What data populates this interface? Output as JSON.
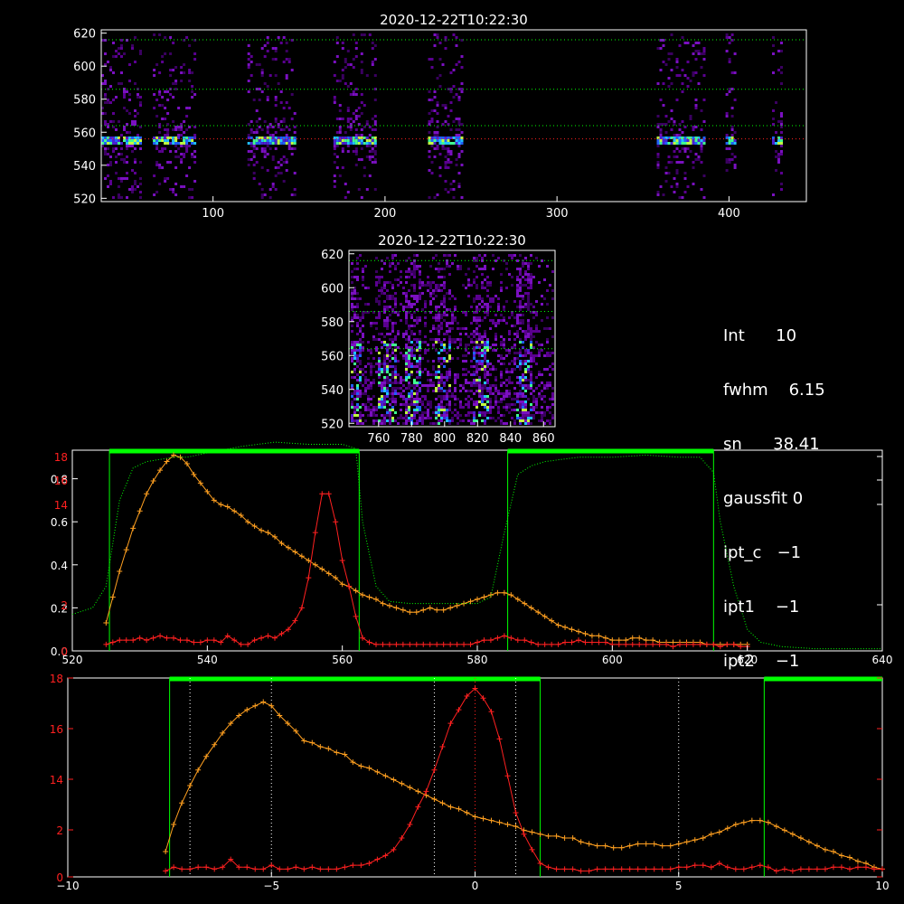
{
  "colors": {
    "background": "#000000",
    "frame": "#ffffff",
    "green": "#00ff00",
    "red": "#ff2020",
    "orange": "#ffa020"
  },
  "info_panel": [
    {
      "label": "Int",
      "value": "10"
    },
    {
      "label": "fwhm",
      "value": "6.15"
    },
    {
      "label": "sn",
      "value": "38.41"
    },
    {
      "label": "gaussfit",
      "value": "0"
    },
    {
      "label": "ipt_c",
      "value": "−1"
    },
    {
      "label": "ipt1",
      "value": "−1"
    },
    {
      "label": "ipt2",
      "value": "−1"
    }
  ],
  "chart_data": [
    {
      "type": "heatmap",
      "title": "2020-12-22T10:22:30",
      "xlim": [
        35,
        445
      ],
      "ylim": [
        518,
        622
      ],
      "xticks": [
        "100",
        "200",
        "300",
        "400"
      ],
      "yticks": [
        "520",
        "540",
        "560",
        "580",
        "600",
        "620"
      ],
      "bright_bands_x": [
        [
          35,
          58
        ],
        [
          65,
          90
        ],
        [
          120,
          148
        ],
        [
          170,
          195
        ],
        [
          225,
          245
        ],
        [
          358,
          385
        ],
        [
          398,
          403
        ],
        [
          425,
          430
        ]
      ],
      "hlines_green_y": [
        616,
        586,
        564
      ],
      "hline_red_y": 556
    },
    {
      "type": "heatmap",
      "title": "2020-12-22T10:22:30",
      "xlim": [
        742,
        867
      ],
      "ylim": [
        518,
        622
      ],
      "xticks": [
        "760",
        "780",
        "800",
        "820",
        "840",
        "860"
      ],
      "yticks": [
        "520",
        "540",
        "560",
        "580",
        "600",
        "620"
      ],
      "hlines_green_y": [
        616,
        586,
        564
      ]
    },
    {
      "type": "line",
      "xlim": [
        520,
        640
      ],
      "xticks": [
        "520",
        "540",
        "560",
        "580",
        "600",
        "620",
        "640"
      ],
      "yticks_white": [
        "0.0",
        "0.2",
        "0.4",
        "0.6",
        "0.8"
      ],
      "yticks_red": [
        "0",
        "2",
        "14",
        "16",
        "18"
      ],
      "green_windows": [
        [
          525.5,
          562.5
        ],
        [
          584.5,
          615
        ]
      ],
      "series": [
        {
          "color": "orange",
          "x": [
            525,
            526,
            527,
            528,
            529,
            530,
            531,
            532,
            533,
            534,
            535,
            536,
            537,
            538,
            539,
            540,
            541,
            542,
            543,
            544,
            545,
            546,
            547,
            548,
            549,
            550,
            551,
            552,
            553,
            554,
            555,
            556,
            557,
            558,
            559,
            560,
            561,
            562,
            563,
            564,
            565,
            566,
            567,
            568,
            569,
            570,
            571,
            572,
            573,
            574,
            575,
            576,
            577,
            578,
            579,
            580,
            581,
            582,
            583,
            584,
            585,
            586,
            587,
            588,
            589,
            590,
            591,
            592,
            593,
            594,
            595,
            596,
            597,
            598,
            599,
            600,
            601,
            602,
            603,
            604,
            605,
            606,
            607,
            608,
            609,
            610,
            611,
            612,
            613,
            614,
            615,
            616,
            617,
            618,
            619,
            620
          ],
          "y": [
            0.13,
            0.25,
            0.37,
            0.47,
            0.57,
            0.65,
            0.73,
            0.79,
            0.84,
            0.88,
            0.91,
            0.9,
            0.87,
            0.82,
            0.78,
            0.74,
            0.7,
            0.68,
            0.67,
            0.65,
            0.63,
            0.6,
            0.58,
            0.56,
            0.55,
            0.53,
            0.5,
            0.48,
            0.46,
            0.44,
            0.42,
            0.4,
            0.38,
            0.36,
            0.34,
            0.31,
            0.3,
            0.28,
            0.26,
            0.25,
            0.24,
            0.22,
            0.21,
            0.2,
            0.19,
            0.18,
            0.18,
            0.19,
            0.2,
            0.19,
            0.19,
            0.2,
            0.21,
            0.22,
            0.23,
            0.24,
            0.25,
            0.26,
            0.27,
            0.27,
            0.26,
            0.24,
            0.22,
            0.2,
            0.18,
            0.16,
            0.14,
            0.12,
            0.11,
            0.1,
            0.09,
            0.08,
            0.07,
            0.07,
            0.06,
            0.05,
            0.05,
            0.05,
            0.06,
            0.06,
            0.05,
            0.05,
            0.04,
            0.04,
            0.04,
            0.04,
            0.04,
            0.04,
            0.04,
            0.03,
            0.03,
            0.03,
            0.03,
            0.03,
            0.03,
            0.03
          ]
        },
        {
          "color": "red",
          "x": [
            525,
            526,
            527,
            528,
            529,
            530,
            531,
            532,
            533,
            534,
            535,
            536,
            537,
            538,
            539,
            540,
            541,
            542,
            543,
            544,
            545,
            546,
            547,
            548,
            549,
            550,
            551,
            552,
            553,
            554,
            555,
            556,
            557,
            558,
            559,
            560,
            561,
            562,
            563,
            564,
            565,
            566,
            567,
            568,
            569,
            570,
            571,
            572,
            573,
            574,
            575,
            576,
            577,
            578,
            579,
            580,
            581,
            582,
            583,
            584,
            585,
            586,
            587,
            588,
            589,
            590,
            591,
            592,
            593,
            594,
            595,
            596,
            597,
            598,
            599,
            600,
            601,
            602,
            603,
            604,
            605,
            606,
            607,
            608,
            609,
            610,
            611,
            612,
            613,
            614,
            615,
            616,
            617,
            618,
            619,
            620
          ],
          "y": [
            0.03,
            0.04,
            0.05,
            0.05,
            0.05,
            0.06,
            0.05,
            0.06,
            0.07,
            0.06,
            0.06,
            0.05,
            0.05,
            0.04,
            0.04,
            0.05,
            0.05,
            0.04,
            0.07,
            0.05,
            0.03,
            0.03,
            0.05,
            0.06,
            0.07,
            0.06,
            0.08,
            0.1,
            0.14,
            0.2,
            0.34,
            0.55,
            0.73,
            0.73,
            0.6,
            0.42,
            0.3,
            0.16,
            0.06,
            0.04,
            0.03,
            0.03,
            0.03,
            0.03,
            0.03,
            0.03,
            0.03,
            0.03,
            0.03,
            0.03,
            0.03,
            0.03,
            0.03,
            0.03,
            0.03,
            0.04,
            0.05,
            0.05,
            0.06,
            0.07,
            0.06,
            0.05,
            0.05,
            0.04,
            0.03,
            0.03,
            0.03,
            0.03,
            0.04,
            0.04,
            0.05,
            0.04,
            0.04,
            0.04,
            0.04,
            0.03,
            0.03,
            0.03,
            0.03,
            0.03,
            0.03,
            0.03,
            0.03,
            0.03,
            0.02,
            0.03,
            0.03,
            0.03,
            0.03,
            0.03,
            0.03,
            0.02,
            0.03,
            0.03,
            0.02,
            0.02
          ]
        },
        {
          "color": "green",
          "dotted": true,
          "x": [
            520,
            523,
            525,
            527,
            529,
            531,
            533,
            535,
            537,
            540,
            545,
            550,
            555,
            560,
            562,
            563,
            565,
            567,
            570,
            575,
            580,
            582,
            584,
            586,
            588,
            590,
            595,
            600,
            605,
            610,
            613,
            615,
            616,
            618,
            620,
            622,
            625,
            630,
            635,
            640
          ],
          "y": [
            0.17,
            0.2,
            0.3,
            0.7,
            0.85,
            0.88,
            0.89,
            0.9,
            0.9,
            0.92,
            0.95,
            0.97,
            0.96,
            0.96,
            0.94,
            0.6,
            0.3,
            0.23,
            0.22,
            0.22,
            0.22,
            0.25,
            0.55,
            0.82,
            0.86,
            0.88,
            0.9,
            0.9,
            0.91,
            0.9,
            0.9,
            0.83,
            0.6,
            0.3,
            0.1,
            0.04,
            0.02,
            0.01,
            0.01,
            0.01
          ]
        }
      ]
    },
    {
      "type": "line",
      "xlim": [
        -10,
        10
      ],
      "xticks": [
        "−10",
        "−5",
        "0",
        "5",
        "10"
      ],
      "yticks": [
        "0",
        "2",
        "14",
        "16",
        "18"
      ],
      "green_windows": [
        [
          -7.5,
          1.6
        ],
        [
          7.1,
          10
        ]
      ],
      "vlines_white_dotted": [
        -7,
        -5,
        -1,
        1,
        5
      ],
      "vline_red_dotted": 0,
      "series": [
        {
          "color": "orange",
          "x": [
            -7.6,
            -7.4,
            -7.2,
            -7,
            -6.8,
            -6.6,
            -6.4,
            -6.2,
            -6,
            -5.8,
            -5.6,
            -5.4,
            -5.2,
            -5,
            -4.8,
            -4.6,
            -4.4,
            -4.2,
            -4,
            -3.8,
            -3.6,
            -3.4,
            -3.2,
            -3,
            -2.8,
            -2.6,
            -2.4,
            -2.2,
            -2,
            -1.8,
            -1.6,
            -1.4,
            -1.2,
            -1,
            -0.8,
            -0.6,
            -0.4,
            -0.2,
            0,
            0.2,
            0.4,
            0.6,
            0.8,
            1,
            1.2,
            1.4,
            1.6,
            1.8,
            2,
            2.2,
            2.4,
            2.6,
            2.8,
            3,
            3.2,
            3.4,
            3.6,
            3.8,
            4,
            4.2,
            4.4,
            4.6,
            4.8,
            5,
            5.2,
            5.4,
            5.6,
            5.8,
            6,
            6.2,
            6.4,
            6.6,
            6.8,
            7,
            7.2,
            7.4,
            7.6,
            7.8,
            8,
            8.2,
            8.4,
            8.6,
            8.8,
            9,
            9.2,
            9.4,
            9.6,
            9.8,
            10
          ],
          "y": [
            0.13,
            0.27,
            0.38,
            0.47,
            0.55,
            0.62,
            0.68,
            0.74,
            0.79,
            0.83,
            0.86,
            0.88,
            0.9,
            0.88,
            0.83,
            0.79,
            0.75,
            0.7,
            0.69,
            0.67,
            0.66,
            0.64,
            0.63,
            0.59,
            0.57,
            0.56,
            0.54,
            0.52,
            0.5,
            0.48,
            0.46,
            0.44,
            0.42,
            0.4,
            0.38,
            0.36,
            0.35,
            0.33,
            0.31,
            0.3,
            0.29,
            0.28,
            0.27,
            0.26,
            0.24,
            0.23,
            0.22,
            0.21,
            0.21,
            0.2,
            0.2,
            0.18,
            0.17,
            0.16,
            0.16,
            0.15,
            0.15,
            0.16,
            0.17,
            0.17,
            0.17,
            0.16,
            0.16,
            0.17,
            0.18,
            0.19,
            0.2,
            0.22,
            0.23,
            0.25,
            0.27,
            0.28,
            0.29,
            0.29,
            0.28,
            0.26,
            0.24,
            0.22,
            0.2,
            0.18,
            0.16,
            0.14,
            0.13,
            0.11,
            0.1,
            0.08,
            0.07,
            0.05,
            0.04
          ]
        },
        {
          "color": "red",
          "x": [
            -7.6,
            -7.4,
            -7.2,
            -7,
            -6.8,
            -6.6,
            -6.4,
            -6.2,
            -6,
            -5.8,
            -5.6,
            -5.4,
            -5.2,
            -5,
            -4.8,
            -4.6,
            -4.4,
            -4.2,
            -4,
            -3.8,
            -3.6,
            -3.4,
            -3.2,
            -3,
            -2.8,
            -2.6,
            -2.4,
            -2.2,
            -2,
            -1.8,
            -1.6,
            -1.4,
            -1.2,
            -1,
            -0.8,
            -0.6,
            -0.4,
            -0.2,
            0,
            0.2,
            0.4,
            0.6,
            0.8,
            1,
            1.2,
            1.4,
            1.6,
            1.8,
            2,
            2.2,
            2.4,
            2.6,
            2.8,
            3,
            3.2,
            3.4,
            3.6,
            3.8,
            4,
            4.2,
            4.4,
            4.6,
            4.8,
            5,
            5.2,
            5.4,
            5.6,
            5.8,
            6,
            6.2,
            6.4,
            6.6,
            6.8,
            7,
            7.2,
            7.4,
            7.6,
            7.8,
            8,
            8.2,
            8.4,
            8.6,
            8.8,
            9,
            9.2,
            9.4,
            9.6,
            9.8,
            10
          ],
          "y": [
            0.03,
            0.05,
            0.04,
            0.04,
            0.05,
            0.05,
            0.04,
            0.05,
            0.09,
            0.05,
            0.05,
            0.04,
            0.04,
            0.06,
            0.04,
            0.04,
            0.05,
            0.04,
            0.05,
            0.04,
            0.04,
            0.04,
            0.05,
            0.06,
            0.06,
            0.07,
            0.09,
            0.11,
            0.14,
            0.2,
            0.27,
            0.36,
            0.44,
            0.55,
            0.67,
            0.79,
            0.86,
            0.93,
            0.97,
            0.92,
            0.85,
            0.71,
            0.52,
            0.33,
            0.22,
            0.14,
            0.07,
            0.05,
            0.04,
            0.04,
            0.04,
            0.03,
            0.03,
            0.04,
            0.04,
            0.04,
            0.04,
            0.04,
            0.04,
            0.04,
            0.04,
            0.04,
            0.04,
            0.05,
            0.05,
            0.06,
            0.06,
            0.05,
            0.07,
            0.05,
            0.04,
            0.04,
            0.05,
            0.06,
            0.05,
            0.03,
            0.04,
            0.03,
            0.04,
            0.04,
            0.04,
            0.04,
            0.05,
            0.05,
            0.04,
            0.05,
            0.05,
            0.04,
            0.04
          ]
        }
      ]
    }
  ]
}
